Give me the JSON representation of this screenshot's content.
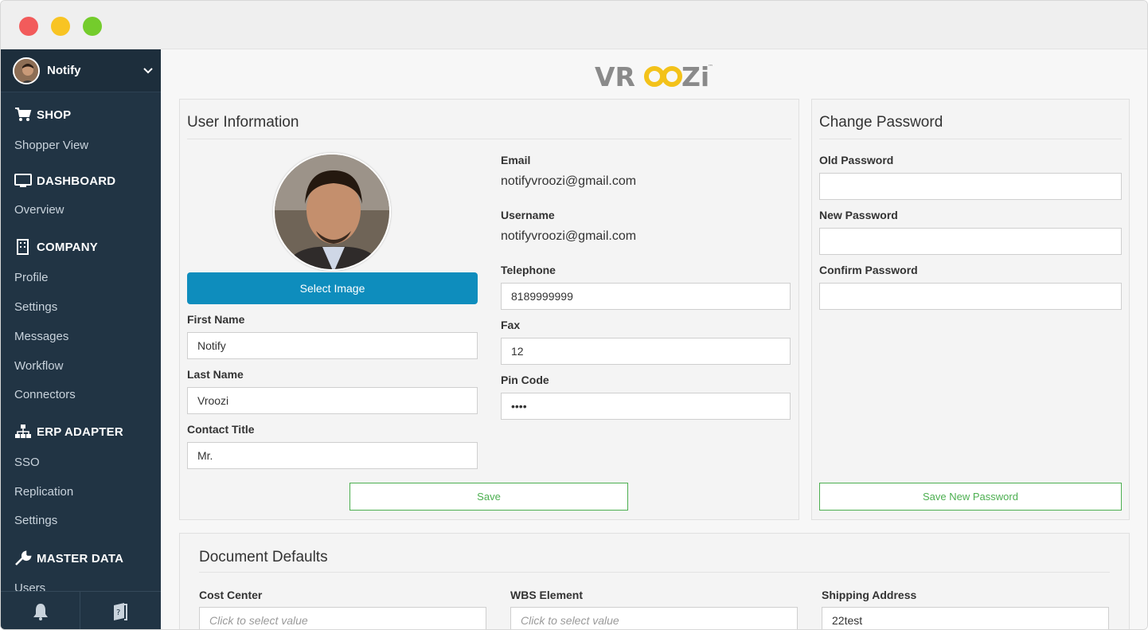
{
  "sidebar": {
    "user_name": "Notify",
    "sections": [
      {
        "heading": "SHOP",
        "icon": "cart-icon",
        "items": [
          "Shopper View"
        ]
      },
      {
        "heading": "DASHBOARD",
        "icon": "monitor-icon",
        "items": [
          "Overview"
        ]
      },
      {
        "heading": "COMPANY",
        "icon": "building-icon",
        "items": [
          "Profile",
          "Settings",
          "Messages",
          "Workflow",
          "Connectors"
        ]
      },
      {
        "heading": "ERP ADAPTER",
        "icon": "sitemap-icon",
        "items": [
          "SSO",
          "Replication",
          "Settings"
        ]
      },
      {
        "heading": "MASTER DATA",
        "icon": "wrench-icon",
        "items": [
          "Users"
        ]
      }
    ],
    "bottom_icons": [
      "bell-icon",
      "book-icon"
    ]
  },
  "logo": {
    "text": "VROOZI",
    "tm": "™"
  },
  "user_info": {
    "title": "User Information",
    "select_image": "Select Image",
    "first_name_label": "First Name",
    "first_name": "Notify",
    "last_name_label": "Last Name",
    "last_name": "Vroozi",
    "contact_title_label": "Contact Title",
    "contact_title": "Mr.",
    "email_label": "Email",
    "email": "notifyvroozi@gmail.com",
    "username_label": "Username",
    "username": "notifyvroozi@gmail.com",
    "telephone_label": "Telephone",
    "telephone": "8189999999",
    "fax_label": "Fax",
    "fax": "12",
    "pin_label": "Pin Code",
    "pin": "••••",
    "save": "Save"
  },
  "change_password": {
    "title": "Change Password",
    "old_label": "Old Password",
    "new_label": "New Password",
    "confirm_label": "Confirm Password",
    "save": "Save New Password"
  },
  "document_defaults": {
    "title": "Document Defaults",
    "cost_center_label": "Cost Center",
    "cost_center_placeholder": "Click to select value",
    "wbs_label": "WBS Element",
    "wbs_placeholder": "Click to select value",
    "shipping_label": "Shipping Address",
    "shipping_value": "22test"
  },
  "colors": {
    "sidebar": "#213444",
    "accent": "#0e8dbd",
    "save_green": "#4caf50"
  }
}
